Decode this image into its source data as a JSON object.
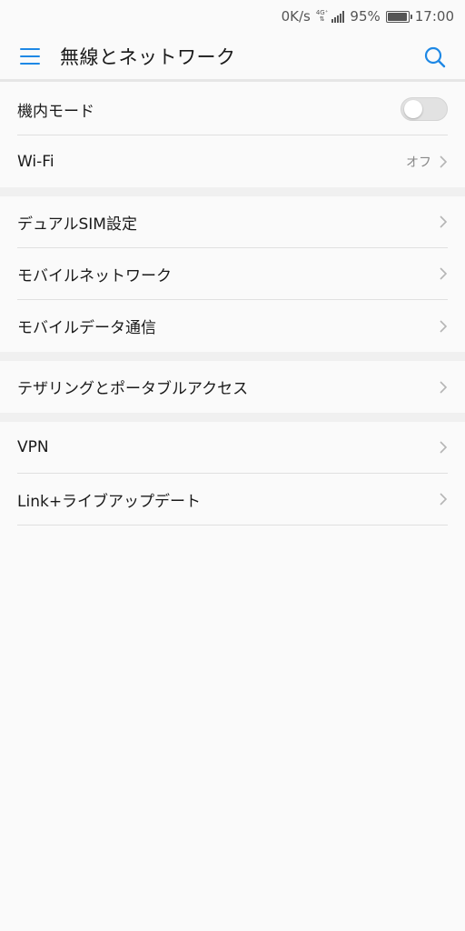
{
  "status_bar": {
    "speed": "0K/s",
    "network_type_top": "4G⁺",
    "network_type_bottom": "⇅",
    "signal_level": 4,
    "battery_percent_text": "95%",
    "battery_level": 0.95,
    "time": "17:00"
  },
  "app_bar": {
    "title": "無線とネットワーク",
    "menu_icon": "hamburger-menu-icon",
    "search_icon": "search-icon",
    "accent_color": "#1e88e5"
  },
  "sections": [
    {
      "items": [
        {
          "label": "機内モード",
          "type": "toggle",
          "toggle_on": false
        },
        {
          "label": "Wi-Fi",
          "type": "link",
          "value": "オフ"
        }
      ]
    },
    {
      "items": [
        {
          "label": "デュアルSIM設定",
          "type": "link"
        },
        {
          "label": "モバイルネットワーク",
          "type": "link"
        },
        {
          "label": "モバイルデータ通信",
          "type": "link"
        }
      ]
    },
    {
      "items": [
        {
          "label": "テザリングとポータブルアクセス",
          "type": "link"
        }
      ]
    },
    {
      "items": [
        {
          "label": "VPN",
          "type": "link"
        },
        {
          "label": "Link+ライブアップデート",
          "type": "link"
        }
      ]
    }
  ]
}
